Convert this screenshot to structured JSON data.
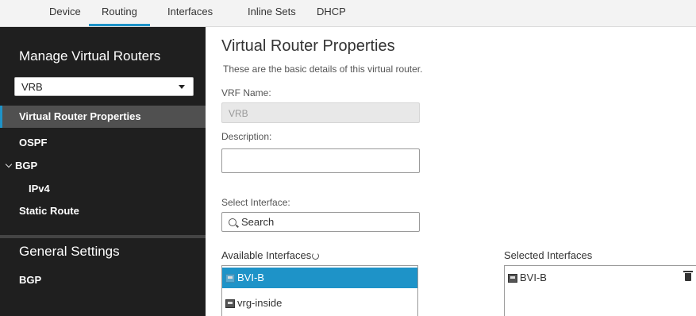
{
  "tabs": [
    {
      "label": "Device"
    },
    {
      "label": "Routing"
    },
    {
      "label": "Interfaces"
    },
    {
      "label": "Inline Sets"
    },
    {
      "label": "DHCP"
    }
  ],
  "sidebar": {
    "title": "Manage Virtual Routers",
    "vrf_selected": "VRB",
    "items": [
      {
        "label": "Virtual Router Properties"
      },
      {
        "label": "OSPF"
      },
      {
        "label": "BGP"
      },
      {
        "label": "IPv4"
      },
      {
        "label": "Static Route"
      }
    ],
    "general_title": "General Settings",
    "general_items": [
      {
        "label": "BGP"
      }
    ]
  },
  "main": {
    "title": "Virtual Router Properties",
    "subtitle": "These are the basic details of this virtual router.",
    "vrf_name_label": "VRF Name:",
    "vrf_name_value": "VRB",
    "description_label": "Description:",
    "description_value": "",
    "select_interface_label": "Select Interface:",
    "search_placeholder": "Search",
    "available_label": "Available Interfaces",
    "selected_label": "Selected Interfaces",
    "available": [
      {
        "name": "BVI-B"
      },
      {
        "name": "vrg-inside"
      }
    ],
    "selected": [
      {
        "name": "BVI-B"
      }
    ]
  },
  "colors": {
    "accent": "#1e93c8",
    "sidebar_bg": "#1f1f1f",
    "active_item_bg": "#505050"
  }
}
